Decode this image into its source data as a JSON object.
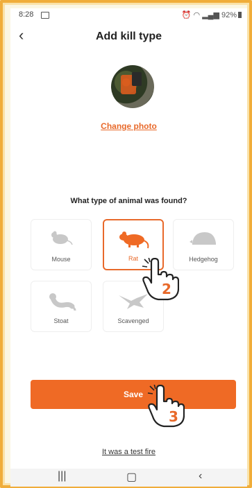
{
  "status_bar": {
    "time": "8:28",
    "right_text": "92%"
  },
  "header": {
    "title": "Add kill type",
    "back_icon": "chevron-left-icon"
  },
  "photo": {
    "change_label": "Change photo"
  },
  "question": "What type of animal was found?",
  "animals": [
    {
      "label": "Mouse",
      "icon": "mouse-icon",
      "selected": false
    },
    {
      "label": "Rat",
      "icon": "rat-icon",
      "selected": true
    },
    {
      "label": "Hedgehog",
      "icon": "hedgehog-icon",
      "selected": false
    },
    {
      "label": "Stoat",
      "icon": "stoat-icon",
      "selected": false
    },
    {
      "label": "Scavenged",
      "icon": "scavenged-icon",
      "selected": false
    }
  ],
  "save_label": "Save",
  "test_fire_label": "It was a test fire",
  "annotations": {
    "step_select": "2",
    "step_save": "3"
  },
  "colors": {
    "accent": "#ef6a25",
    "frame": "#f0ad3a",
    "icon_gray": "#c8c8c8"
  }
}
